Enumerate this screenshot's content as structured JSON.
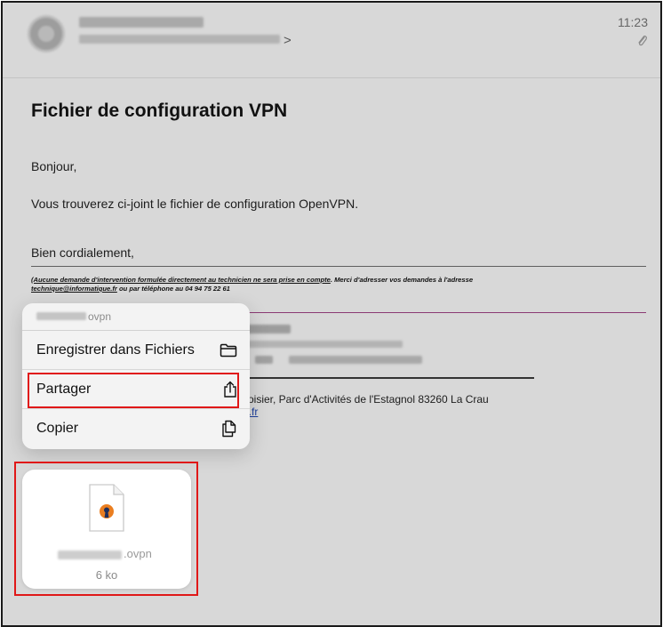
{
  "header": {
    "time": "11:23",
    "chevron": ">",
    "icons": {
      "avatar": "sender-avatar",
      "attachment": "paperclip-icon"
    }
  },
  "email": {
    "subject": "Fichier de configuration VPN",
    "greeting": "Bonjour,",
    "body": "Vous trouverez ci-joint le fichier de configuration OpenVPN.",
    "closing": "Bien cordialement,",
    "disclaimer": {
      "part1": "(Aucune demande d'intervention formulée directement au technicien ne sera prise en compte",
      "part2": ". Merci d'adresser vos demandes à l'adresse ",
      "email": "technique@informatique.fr",
      "part3": " ou par téléphone au 04 94 75 22 61"
    },
    "address": "voisier, Parc d'Activités de l'Estagnol    83260 La Crau",
    "link_fragment": "e.fr"
  },
  "context_menu": {
    "filename_ext": "ovpn",
    "items": [
      {
        "label": "Enregistrer dans Fichiers",
        "icon": "folder-icon"
      },
      {
        "label": "Partager",
        "icon": "share-icon"
      },
      {
        "label": "Copier",
        "icon": "copy-icon"
      }
    ]
  },
  "attachment": {
    "extension": ".ovpn",
    "size": "6 ko",
    "icon": "openvpn-file-icon"
  },
  "colors": {
    "highlight": "#e01818",
    "link": "#1d3f9c",
    "purple_rule": "#8b3a74"
  }
}
